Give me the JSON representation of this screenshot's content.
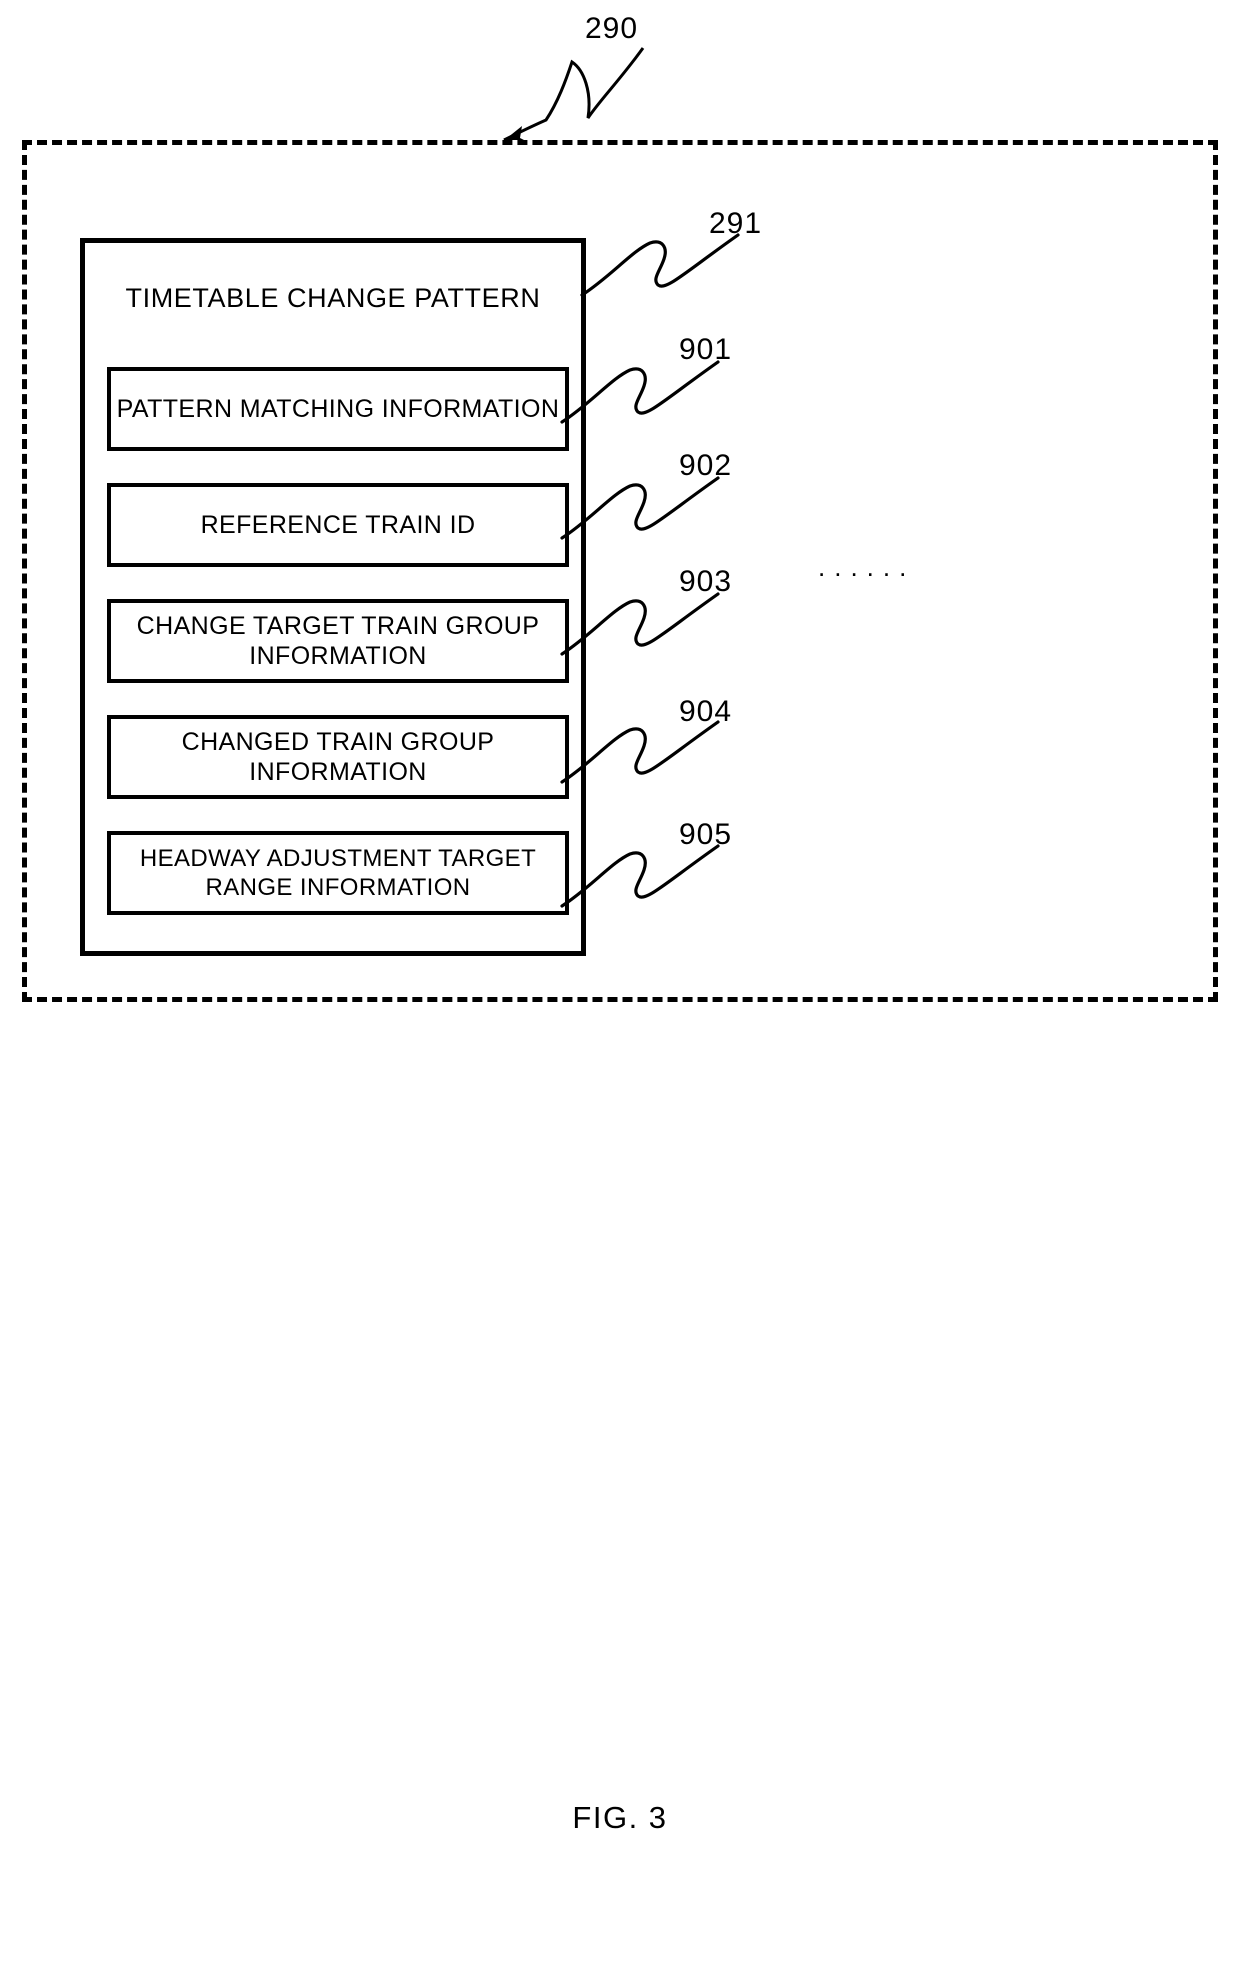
{
  "figure": {
    "caption": "FIG. 3",
    "outer_ref": "290",
    "ellipsis": "......",
    "ink_color": "#000000",
    "background_color": "#ffffff"
  },
  "pattern_box": {
    "ref": "291",
    "title": "TIMETABLE CHANGE PATTERN",
    "fields": [
      {
        "ref": "901",
        "label": "PATTERN MATCHING INFORMATION"
      },
      {
        "ref": "902",
        "label": "REFERENCE TRAIN ID"
      },
      {
        "ref": "903",
        "label": "CHANGE TARGET TRAIN GROUP INFORMATION"
      },
      {
        "ref": "904",
        "label": "CHANGED TRAIN GROUP INFORMATION"
      },
      {
        "ref": "905",
        "label": "HEADWAY ADJUSTMENT TARGET RANGE INFORMATION"
      }
    ]
  }
}
